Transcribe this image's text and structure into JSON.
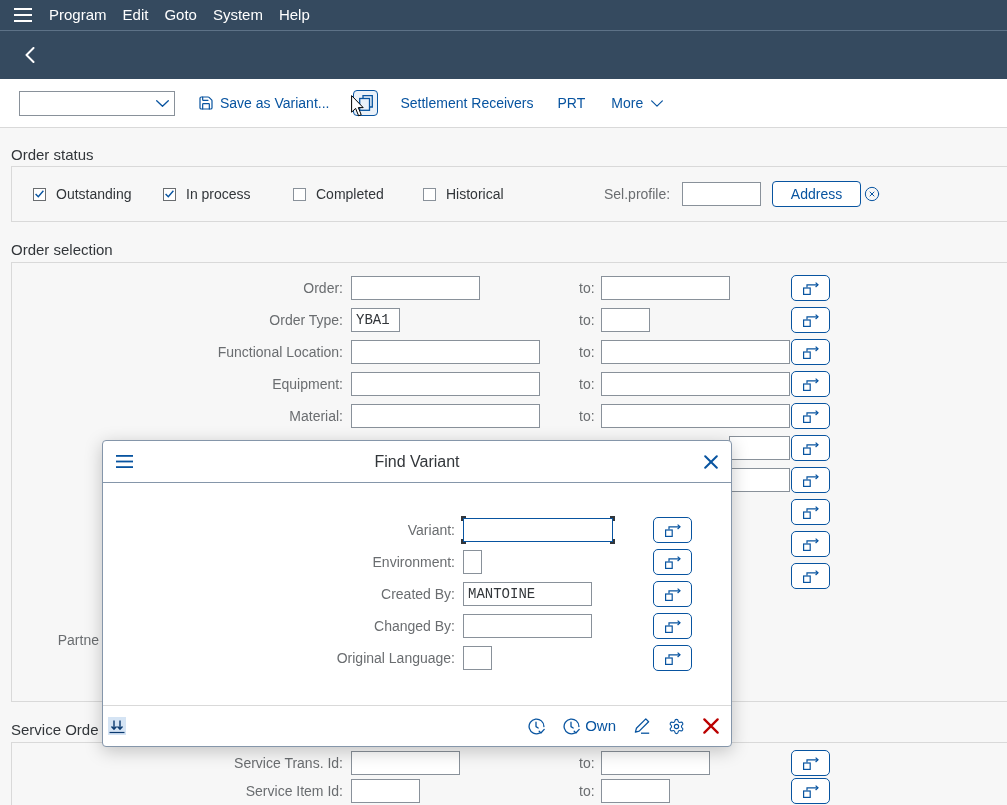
{
  "menu_bar": {
    "items": [
      "Program",
      "Edit",
      "Goto",
      "System",
      "Help"
    ]
  },
  "toolbar": {
    "buttons": [
      {
        "kind": "icon_label",
        "label": "Save as Variant...",
        "focused": false
      },
      {
        "kind": "icon",
        "focused": true
      },
      {
        "kind": "label",
        "label": "Settlement Receivers",
        "focused": false
      },
      {
        "kind": "label",
        "label": "PRT",
        "focused": false
      },
      {
        "kind": "menu",
        "label": "More",
        "focused": false
      }
    ]
  },
  "order_status": {
    "title": "Order status",
    "checkboxes": [
      {
        "label": "Outstanding",
        "checked": true
      },
      {
        "label": "In process",
        "checked": true
      },
      {
        "label": "Completed",
        "checked": false
      },
      {
        "label": "Historical",
        "checked": false
      }
    ],
    "profile_label": "Sel.profile:",
    "address_button": "Address"
  },
  "order_selection": {
    "title": "Order selection",
    "rows": [
      {
        "label": "Order:",
        "to_label": "to:",
        "to_field": true,
        "multiple_selection": true
      },
      {
        "label": "Order Type:",
        "value": "YBA1",
        "to_label": "to:",
        "to_field": true,
        "multiple_selection": true
      },
      {
        "label": "Functional Location:",
        "to_label": "to:",
        "to_field": true,
        "multiple_selection": true
      },
      {
        "label": "Equipment:",
        "to_label": "to:",
        "to_field": true,
        "multiple_selection": true
      },
      {
        "label": "Material:",
        "to_label": "to:",
        "to_field": true,
        "multiple_selection": true
      },
      {
        "to_field": true,
        "multiple_selection": true
      },
      {
        "to_field": true,
        "multiple_selection": true
      },
      {
        "to_field": false,
        "multiple_selection": true
      },
      {
        "to_field": false,
        "multiple_selection": true
      },
      {
        "to_field": false,
        "multiple_selection": true
      }
    ],
    "partial_label": "Partne"
  },
  "service_order": {
    "title": "Service Orde",
    "rows": [
      {
        "label": "Service Trans. Id:",
        "to_label": "to:",
        "to_field": true,
        "multiple_selection": true
      },
      {
        "label": "Service Item Id:",
        "to_label": "to:",
        "to_field": true,
        "multiple_selection": true
      }
    ]
  },
  "dialog": {
    "title": "Find Variant",
    "fields": [
      {
        "label": "Variant:",
        "focused": true
      },
      {
        "label": "Environment:",
        "focused": false
      },
      {
        "label": "Created By:",
        "value": "MANTOINE",
        "focused": false
      },
      {
        "label": "Changed By:",
        "focused": false
      },
      {
        "label": "Original Language:",
        "focused": false
      }
    ],
    "own_button": "Own"
  }
}
